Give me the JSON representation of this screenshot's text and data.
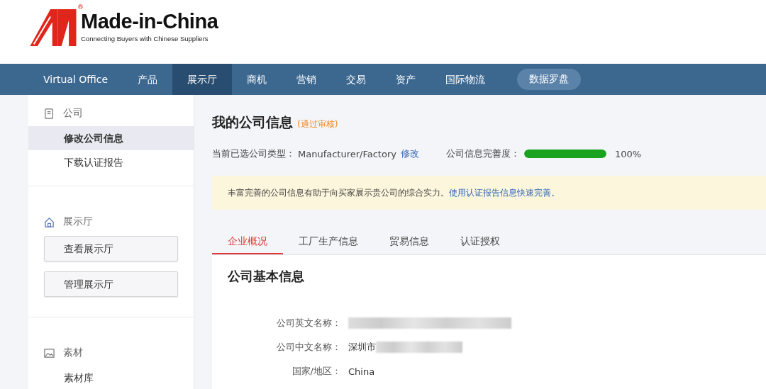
{
  "logo": {
    "name": "Made-in-China",
    "mark": "®",
    "tagline": "Connecting Buyers with Chinese Suppliers"
  },
  "nav": [
    {
      "label": "Virtual Office",
      "selected": false,
      "kind": "link"
    },
    {
      "label": "产品",
      "selected": false,
      "kind": "link"
    },
    {
      "label": "展示厅",
      "selected": true,
      "kind": "link"
    },
    {
      "label": "商机",
      "selected": false,
      "kind": "link"
    },
    {
      "label": "营销",
      "selected": false,
      "kind": "link"
    },
    {
      "label": "交易",
      "selected": false,
      "kind": "link"
    },
    {
      "label": "资产",
      "selected": false,
      "kind": "link"
    },
    {
      "label": "国际物流",
      "selected": false,
      "kind": "link"
    },
    {
      "label": "数据罗盘",
      "selected": false,
      "kind": "pill"
    }
  ],
  "sidebar": [
    {
      "title": "公司",
      "items": [
        {
          "label": "修改公司信息",
          "selected": true,
          "kind": "link"
        },
        {
          "label": "下载认证报告",
          "selected": false,
          "kind": "link"
        }
      ]
    },
    {
      "title": "展示厅",
      "items": [
        {
          "label": "查看展示厅",
          "selected": false,
          "kind": "button"
        },
        {
          "label": "管理展示厅",
          "selected": false,
          "kind": "button"
        }
      ]
    },
    {
      "title": "素材",
      "items": [
        {
          "label": "素材库",
          "selected": false,
          "kind": "link"
        }
      ]
    }
  ],
  "page": {
    "title": "我的公司信息",
    "status": "(通过审核)",
    "type_label": "当前已选公司类型：",
    "type_value": "Manufacturer/Factory",
    "type_edit": "修改",
    "completeness_label": "公司信息完善度：",
    "completeness": {
      "level": 1.0
    },
    "completeness_reading": "100%",
    "notice": "丰富完善的公司信息有助于向买家展示贵公司的综合实力。",
    "notice_link": "使用认证报告信息快速完善。"
  },
  "tabs": [
    {
      "label": "企业概况",
      "selected": true
    },
    {
      "label": "工厂生产信息",
      "selected": false
    },
    {
      "label": "贸易信息",
      "selected": false
    },
    {
      "label": "认证授权",
      "selected": false
    }
  ],
  "section": {
    "title": "公司基本信息",
    "fields": [
      {
        "label": "公司英文名称：",
        "blurred": true
      },
      {
        "label": "公司中文名称：",
        "value": "深圳市",
        "blurred": true
      },
      {
        "label": "国家/地区：",
        "value": "China",
        "blurred": false
      }
    ]
  }
}
